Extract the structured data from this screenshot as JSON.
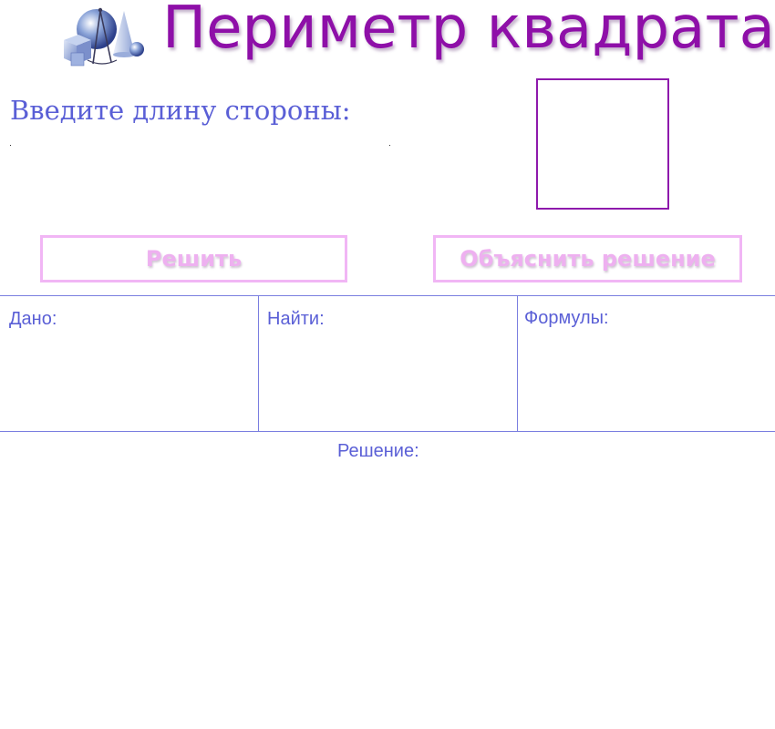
{
  "header": {
    "title": "Периметр квадрата",
    "logo_icon": "geometry-shapes-icon"
  },
  "input_section": {
    "prompt": "Введите длину стороны:",
    "value": "",
    "placeholder": ""
  },
  "figure": {
    "shape": "square",
    "stroke_color": "#8e19ac"
  },
  "buttons": {
    "solve_label": "Решить",
    "explain_label": "Объяснить решение"
  },
  "table": {
    "given_label": "Дано:",
    "find_label": "Найти:",
    "formulas_label": "Формулы:"
  },
  "solution": {
    "label": "Решение:"
  },
  "colors": {
    "title": "#8e0fa8",
    "text": "#5a5fd6",
    "button_border": "#f1b6f5",
    "button_text": "#eeb0f0",
    "lines": "#7a7ee0"
  }
}
